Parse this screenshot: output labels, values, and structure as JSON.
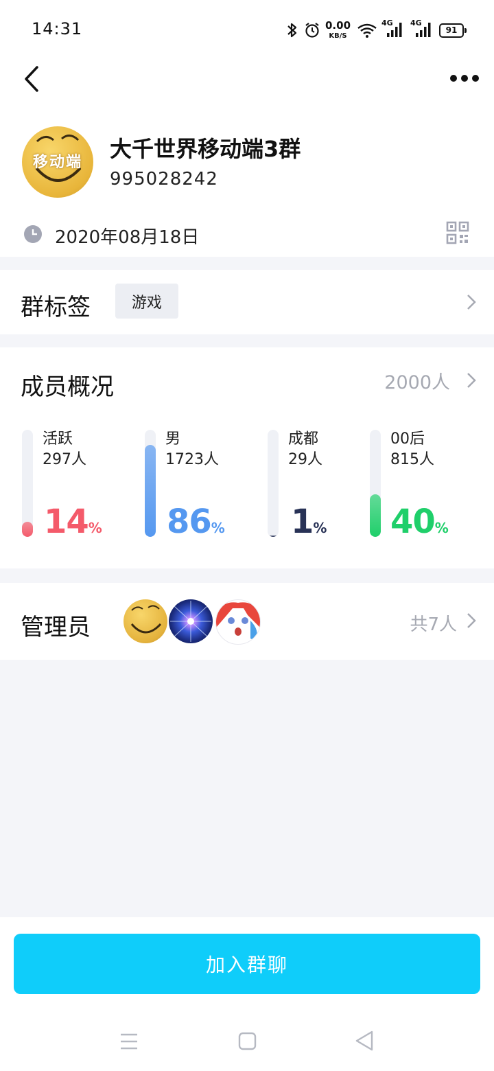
{
  "status_bar": {
    "time": "14:31",
    "net_speed_value": "0.00",
    "net_speed_unit": "KB/S",
    "signal_1": "4G",
    "signal_2": "4G",
    "battery": "91",
    "icons": [
      "bluetooth-icon",
      "alarm-icon",
      "wifi-icon",
      "signal-icon",
      "battery-icon"
    ]
  },
  "nav": {
    "back_icon": "chevron-left-icon",
    "more_icon": "more-dots-icon"
  },
  "group": {
    "avatar_text": "移动端",
    "name": "大千世界移动端3群",
    "id": "995028242",
    "created_date": "2020年08月18日"
  },
  "tags": {
    "title": "群标签",
    "chips": [
      "游戏"
    ]
  },
  "members": {
    "title": "成员概况",
    "count": "2000人",
    "stats": [
      {
        "label": "活跃",
        "count": "297人",
        "percent": "14",
        "fraction": 0.14,
        "color": "#f45a6a"
      },
      {
        "label": "男",
        "count": "1723人",
        "percent": "86",
        "fraction": 0.86,
        "color": "#5598f0"
      },
      {
        "label": "成都",
        "count": "29人",
        "percent": "1",
        "fraction": 0.01,
        "color": "#283256"
      },
      {
        "label": "00后",
        "count": "815人",
        "percent": "40",
        "fraction": 0.4,
        "color": "#1fcf6a"
      }
    ],
    "percent_sign": "%"
  },
  "admins": {
    "title": "管理员",
    "count": "共7人"
  },
  "join_button": "加入群聊",
  "colors": {
    "accent": "#0fcdfa",
    "muted": "#a6a9b2",
    "page_bg": "#f4f5f9"
  }
}
